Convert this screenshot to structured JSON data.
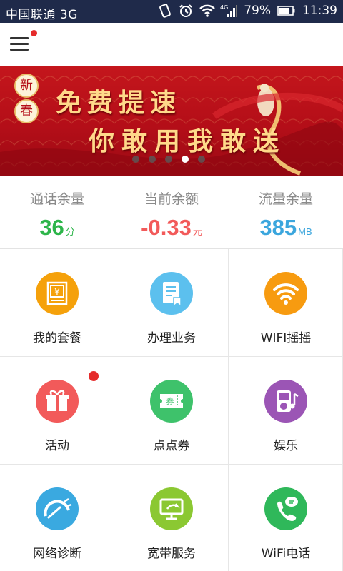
{
  "status_bar": {
    "carrier": "中国联通 3G",
    "battery": "79%",
    "time": "11:39",
    "net_label": "4G"
  },
  "app_bar": {
    "menu_icon": "hamburger-menu-icon",
    "has_notification_dot": true
  },
  "banner": {
    "seal_top": "新",
    "seal_bottom": "春",
    "line1": "免费提速",
    "line2": "你敢用我敢送",
    "slide_count": 5,
    "active_index": 3,
    "colors": {
      "bg": "#c4161c",
      "text": "#ffd98a"
    }
  },
  "balances": [
    {
      "label": "通话余量",
      "value": "36",
      "unit": "分",
      "color": "#2db54a"
    },
    {
      "label": "当前余额",
      "value": "-0.33",
      "unit": "元",
      "color": "#f25a5a"
    },
    {
      "label": "流量余量",
      "value": "385",
      "unit": "MB",
      "color": "#3ba6dd"
    }
  ],
  "grid": [
    {
      "label": "我的套餐",
      "icon": "package-receipt-icon",
      "color": "#f5a10b",
      "badge": false
    },
    {
      "label": "办理业务",
      "icon": "document-bookmark-icon",
      "color": "#5cc0ee",
      "badge": false
    },
    {
      "label": "WIFI摇摇",
      "icon": "wifi-icon",
      "color": "#f79b10",
      "badge": false
    },
    {
      "label": "活动",
      "icon": "gift-icon",
      "color": "#f25a5a",
      "badge": true
    },
    {
      "label": "点点券",
      "icon": "coupon-ticket-icon",
      "color": "#3ec26b",
      "badge": false
    },
    {
      "label": "娱乐",
      "icon": "music-player-icon",
      "color": "#9b55b5",
      "badge": false
    },
    {
      "label": "网络诊断",
      "icon": "speed-gauge-icon",
      "color": "#3aa9e0",
      "badge": false
    },
    {
      "label": "宽带服务",
      "icon": "broadband-monitor-icon",
      "color": "#8bc832",
      "badge": false
    },
    {
      "label": "WiFi电话",
      "icon": "phone-chat-icon",
      "color": "#2fb85a",
      "badge": false
    }
  ]
}
